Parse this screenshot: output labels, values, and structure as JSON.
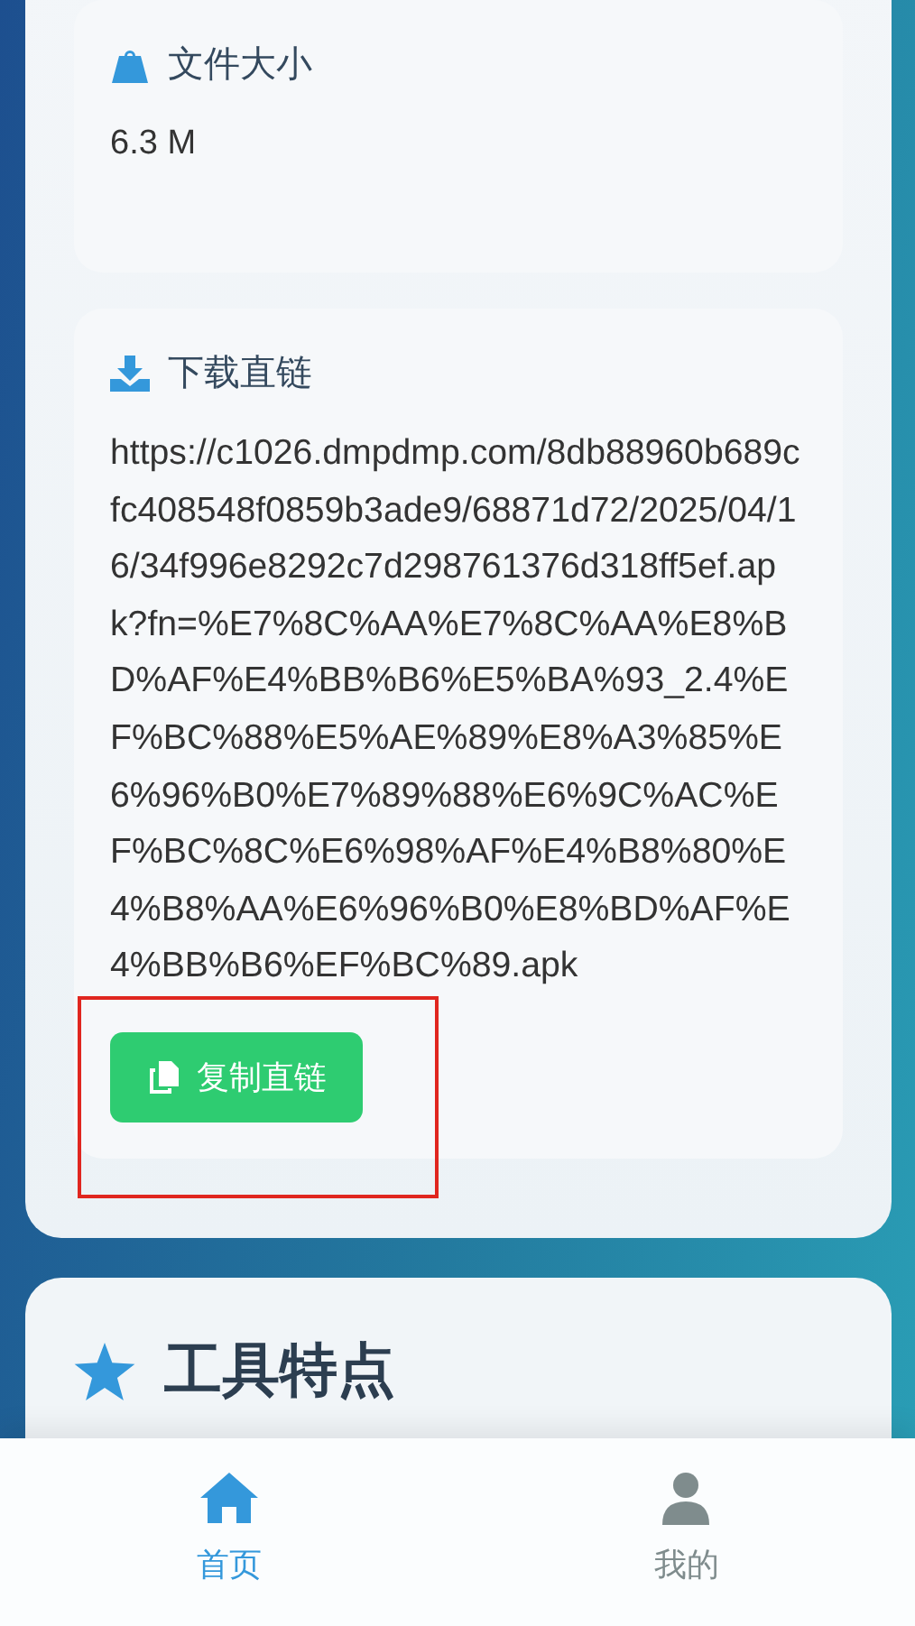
{
  "file_size": {
    "label": "文件大小",
    "value": "6.3 M"
  },
  "download_link": {
    "label": "下载直链",
    "url": "https://c1026.dmpdmp.com/8db88960b689cfc408548f0859b3ade9/68871d72/2025/04/16/34f996e8292c7d298761376d318ff5ef.apk?fn=%E7%8C%AA%E7%8C%AA%E8%BD%AF%E4%BB%B6%E5%BA%93_2.4%EF%BC%88%E5%AE%89%E8%A3%85%E6%96%B0%E7%89%88%E6%9C%AC%EF%BC%8C%E6%98%AF%E4%B8%80%E4%B8%AA%E6%96%B0%E8%BD%AF%E4%BB%B6%EF%BC%89.apk",
    "copy_button": "复制直链"
  },
  "features": {
    "title": "工具特点"
  },
  "bottom_nav": [
    {
      "kind": "home",
      "label": "首页",
      "selected": true
    },
    {
      "kind": "profile",
      "label": "我的",
      "selected": false
    }
  ]
}
